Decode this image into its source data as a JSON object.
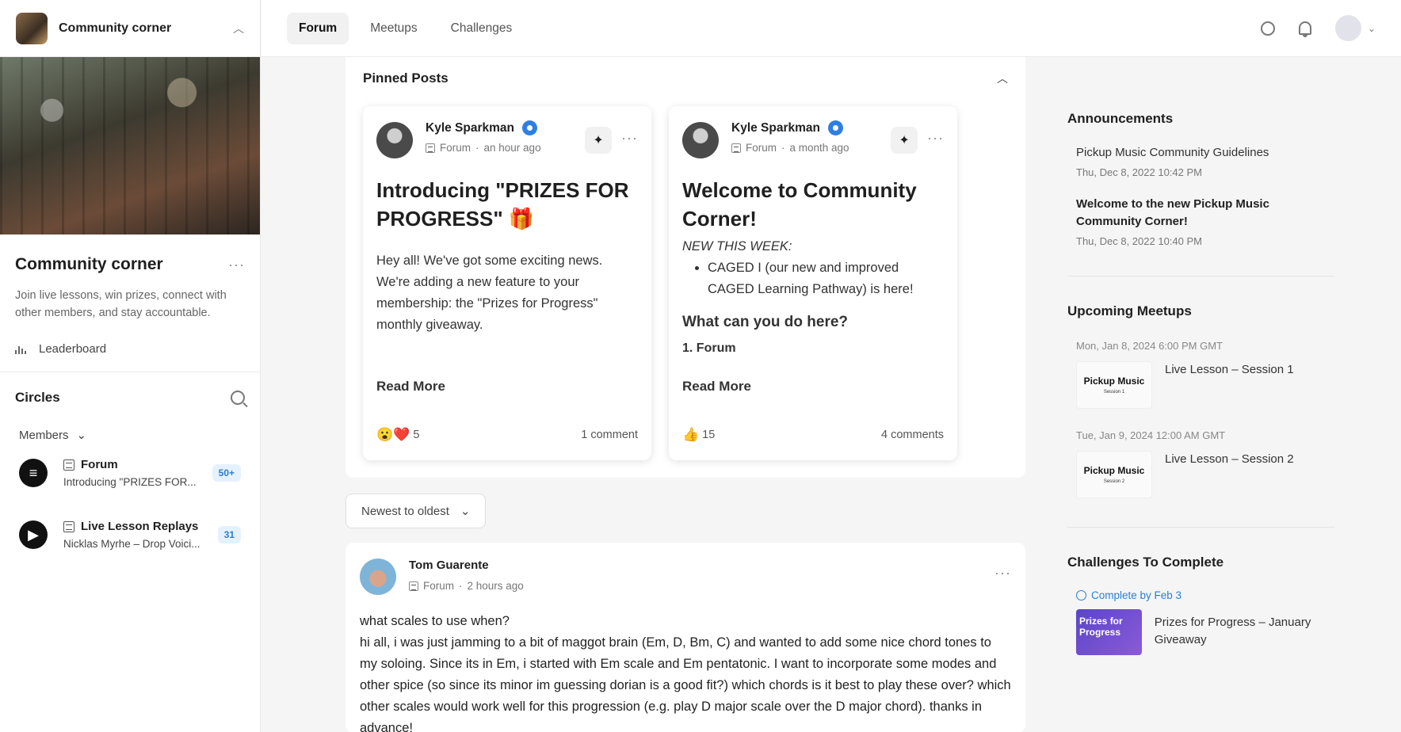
{
  "sidebar": {
    "top_title": "Community corner",
    "community_name": "Community corner",
    "description": "Join live lessons, win prizes, connect with other members, and stay accountable.",
    "leaderboard_label": "Leaderboard",
    "circles_title": "Circles",
    "members_label": "Members",
    "circles": [
      {
        "name": "Forum",
        "subtitle": "Introducing \"PRIZES FOR...",
        "badge": "50+"
      },
      {
        "name": "Live Lesson Replays",
        "subtitle": "Nicklas Myrhe – Drop Voici...",
        "badge": "31"
      }
    ]
  },
  "topnav": {
    "tabs": [
      "Forum",
      "Meetups",
      "Challenges"
    ],
    "active_tab": "Forum"
  },
  "pinned": {
    "title": "Pinned Posts",
    "cards": [
      {
        "author": "Kyle Sparkman",
        "circle": "Forum",
        "time": "an hour ago",
        "title": "Introducing \"PRIZES FOR PROGRESS\" 🎁",
        "body": "Hey all! We've got some exciting news. We're adding a new feature to your membership: the \"Prizes for Progress\" monthly giveaway.",
        "read_more": "Read More",
        "reactions": "😮❤️",
        "reaction_count": "5",
        "comments": "1 comment"
      },
      {
        "author": "Kyle Sparkman",
        "circle": "Forum",
        "time": "a month ago",
        "title": "Welcome to Community Corner!",
        "body_italic": "NEW THIS WEEK:",
        "bullet": "CAGED I (our new and improved CAGED Learning Pathway) is here!",
        "subheading": "What can you do here?",
        "subheading2": "1. Forum",
        "read_more": "Read More",
        "reactions": "👍",
        "reaction_count": "15",
        "comments": "4 comments"
      }
    ]
  },
  "sort": {
    "label": "Newest to oldest"
  },
  "post": {
    "author": "Tom Guarente",
    "circle": "Forum",
    "time": "2 hours ago",
    "title": "what scales to use when?",
    "body": "hi all,  i was just jamming to a bit of maggot brain (Em, D, Bm, C) and wanted to add some nice chord tones to my soloing. Since its in Em, i started with Em scale and Em pentatonic. I want to incorporate some modes and other spice (so since its minor im guessing dorian is a good fit?) which chords is it best to play these over? which other scales would work well for this progression (e.g. play D major scale over the D major chord). thanks in advance!"
  },
  "announcements": {
    "title": "Announcements",
    "items": [
      {
        "title": "Pickup Music Community Guidelines",
        "date": "Thu, Dec 8, 2022 10:42 PM"
      },
      {
        "title": "Welcome to the new Pickup Music Community Corner!",
        "date": "Thu, Dec 8, 2022 10:40 PM"
      }
    ]
  },
  "meetups": {
    "title": "Upcoming Meetups",
    "items": [
      {
        "date": "Mon, Jan 8, 2024 6:00 PM GMT",
        "title": "Live Lesson – Session 1",
        "thumb_brand": "Pickup Music",
        "thumb_session": "Session 1"
      },
      {
        "date": "Tue, Jan 9, 2024 12:00 AM GMT",
        "title": "Live Lesson – Session 2",
        "thumb_brand": "Pickup Music",
        "thumb_session": "Session 2"
      }
    ]
  },
  "challenges": {
    "title": "Challenges To Complete",
    "due": "Complete by Feb 3",
    "item_title": "Prizes for Progress – January Giveaway",
    "thumb_text": "Prizes for Progress"
  }
}
